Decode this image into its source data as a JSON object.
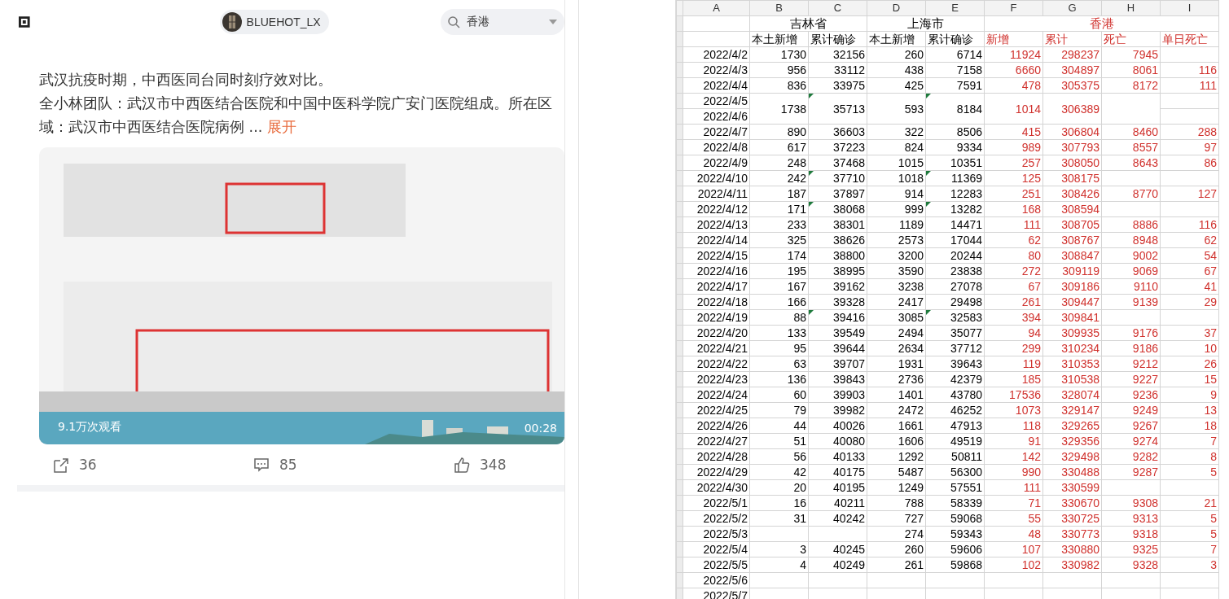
{
  "feed": {
    "user": {
      "name": "BLUEHOT_LX"
    },
    "search": {
      "value": "香港"
    },
    "post": {
      "lines": [
        "武汉抗疫时期，中西医同台同时刻疗效对比。",
        "全小林团队：武汉市中西医结合医院和中国中医科学院广安门医院组成。所在区域：武汉市中西医结合医院病例  ..."
      ],
      "expand": "展开",
      "video": {
        "kind": "picture",
        "views": "9.1万次观看",
        "duration": "00:28"
      },
      "actions": [
        {
          "kind": "share",
          "count": "36"
        },
        {
          "kind": "comment",
          "count": "85"
        },
        {
          "kind": "like",
          "count": "348"
        }
      ]
    }
  },
  "sheet": {
    "column_letters": [
      "A",
      "B",
      "C",
      "D",
      "E",
      "F",
      "G",
      "H",
      "I"
    ],
    "groups": [
      {
        "label": "吉林省",
        "color": "#000000",
        "subheads": [
          "本土新增",
          "累计确诊"
        ]
      },
      {
        "label": "上海市",
        "color": "#000000",
        "subheads": [
          "本土新增",
          "累计确诊"
        ]
      },
      {
        "label": "香港",
        "color": "#d0312d",
        "subheads": [
          "新增",
          "累计",
          "死亡",
          "单日死亡"
        ]
      }
    ],
    "rows": [
      {
        "dates": [
          "2022/4/2"
        ],
        "flagged": false,
        "B": "1730",
        "C": "32156",
        "D": "260",
        "E": "6714",
        "F": "11924",
        "G": "298237",
        "H": "7945"
      },
      {
        "dates": [
          "2022/4/3"
        ],
        "flagged": false,
        "B": "956",
        "C": "33112",
        "D": "438",
        "E": "7158",
        "F": "6660",
        "G": "304897",
        "H": "8061",
        "I": "116"
      },
      {
        "dates": [
          "2022/4/4"
        ],
        "flagged": false,
        "B": "836",
        "C": "33975",
        "D": "425",
        "E": "7591",
        "F": "478",
        "G": "305375",
        "H": "8172",
        "I": "111"
      },
      {
        "dates": [
          "2022/4/5",
          "2022/4/6"
        ],
        "flagged": true,
        "B": "1738",
        "C": "35713",
        "D": "593",
        "E": "8184",
        "F": "1014",
        "G": "306389"
      },
      {
        "dates": [
          "2022/4/7"
        ],
        "flagged": false,
        "B": "890",
        "C": "36603",
        "D": "322",
        "E": "8506",
        "F": "415",
        "G": "306804",
        "H": "8460",
        "I": "288"
      },
      {
        "dates": [
          "2022/4/8"
        ],
        "flagged": false,
        "B": "617",
        "C": "37223",
        "D": "824",
        "E": "9334",
        "F": "989",
        "G": "307793",
        "H": "8557",
        "I": "97"
      },
      {
        "dates": [
          "2022/4/9"
        ],
        "flagged": false,
        "B": "248",
        "C": "37468",
        "D": "1015",
        "E": "10351",
        "F": "257",
        "G": "308050",
        "H": "8643",
        "I": "86"
      },
      {
        "dates": [
          "2022/4/10"
        ],
        "flagged": true,
        "B": "242",
        "C": "37710",
        "D": "1018",
        "E": "11369",
        "F": "125",
        "G": "308175"
      },
      {
        "dates": [
          "2022/4/11"
        ],
        "flagged": false,
        "B": "187",
        "C": "37897",
        "D": "914",
        "E": "12283",
        "F": "251",
        "G": "308426",
        "H": "8770",
        "I": "127"
      },
      {
        "dates": [
          "2022/4/12"
        ],
        "flagged": true,
        "B": "171",
        "C": "38068",
        "D": "999",
        "E": "13282",
        "F": "168",
        "G": "308594"
      },
      {
        "dates": [
          "2022/4/13"
        ],
        "flagged": false,
        "B": "233",
        "C": "38301",
        "D": "1189",
        "E": "14471",
        "F": "111",
        "G": "308705",
        "H": "8886",
        "I": "116"
      },
      {
        "dates": [
          "2022/4/14"
        ],
        "flagged": false,
        "B": "325",
        "C": "38626",
        "D": "2573",
        "E": "17044",
        "F": "62",
        "G": "308767",
        "H": "8948",
        "I": "62"
      },
      {
        "dates": [
          "2022/4/15"
        ],
        "flagged": false,
        "B": "174",
        "C": "38800",
        "D": "3200",
        "E": "20244",
        "F": "80",
        "G": "308847",
        "H": "9002",
        "I": "54"
      },
      {
        "dates": [
          "2022/4/16"
        ],
        "flagged": false,
        "B": "195",
        "C": "38995",
        "D": "3590",
        "E": "23838",
        "F": "272",
        "G": "309119",
        "H": "9069",
        "I": "67"
      },
      {
        "dates": [
          "2022/4/17"
        ],
        "flagged": false,
        "B": "167",
        "C": "39162",
        "D": "3238",
        "E": "27078",
        "F": "67",
        "G": "309186",
        "H": "9110",
        "I": "41"
      },
      {
        "dates": [
          "2022/4/18"
        ],
        "flagged": false,
        "B": "166",
        "C": "39328",
        "D": "2417",
        "E": "29498",
        "F": "261",
        "G": "309447",
        "H": "9139",
        "I": "29"
      },
      {
        "dates": [
          "2022/4/19"
        ],
        "flagged": true,
        "B": "88",
        "C": "39416",
        "D": "3085",
        "E": "32583",
        "F": "394",
        "G": "309841"
      },
      {
        "dates": [
          "2022/4/20"
        ],
        "flagged": false,
        "B": "133",
        "C": "39549",
        "D": "2494",
        "E": "35077",
        "F": "94",
        "G": "309935",
        "H": "9176",
        "I": "37"
      },
      {
        "dates": [
          "2022/4/21"
        ],
        "flagged": false,
        "B": "95",
        "C": "39644",
        "D": "2634",
        "E": "37712",
        "F": "299",
        "G": "310234",
        "H": "9186",
        "I": "10"
      },
      {
        "dates": [
          "2022/4/22"
        ],
        "flagged": false,
        "B": "63",
        "C": "39707",
        "D": "1931",
        "E": "39643",
        "F": "119",
        "G": "310353",
        "H": "9212",
        "I": "26"
      },
      {
        "dates": [
          "2022/4/23"
        ],
        "flagged": false,
        "B": "136",
        "C": "39843",
        "D": "2736",
        "E": "42379",
        "F": "185",
        "G": "310538",
        "H": "9227",
        "I": "15"
      },
      {
        "dates": [
          "2022/4/24"
        ],
        "flagged": false,
        "B": "60",
        "C": "39903",
        "D": "1401",
        "E": "43780",
        "F": "17536",
        "G": "328074",
        "H": "9236",
        "I": "9"
      },
      {
        "dates": [
          "2022/4/25"
        ],
        "flagged": false,
        "B": "79",
        "C": "39982",
        "D": "2472",
        "E": "46252",
        "F": "1073",
        "G": "329147",
        "H": "9249",
        "I": "13"
      },
      {
        "dates": [
          "2022/4/26"
        ],
        "flagged": false,
        "B": "44",
        "C": "40026",
        "D": "1661",
        "E": "47913",
        "F": "118",
        "G": "329265",
        "H": "9267",
        "I": "18"
      },
      {
        "dates": [
          "2022/4/27"
        ],
        "flagged": false,
        "B": "51",
        "C": "40080",
        "D": "1606",
        "E": "49519",
        "F": "91",
        "G": "329356",
        "H": "9274",
        "I": "7"
      },
      {
        "dates": [
          "2022/4/28"
        ],
        "flagged": false,
        "B": "56",
        "C": "40133",
        "D": "1292",
        "E": "50811",
        "F": "142",
        "G": "329498",
        "H": "9282",
        "I": "8"
      },
      {
        "dates": [
          "2022/4/29"
        ],
        "flagged": false,
        "B": "42",
        "C": "40175",
        "D": "5487",
        "E": "56300",
        "F": "990",
        "G": "330488",
        "H": "9287",
        "I": "5"
      },
      {
        "dates": [
          "2022/4/30"
        ],
        "flagged": false,
        "B": "20",
        "C": "40195",
        "D": "1249",
        "E": "57551",
        "F": "111",
        "G": "330599"
      },
      {
        "dates": [
          "2022/5/1"
        ],
        "flagged": false,
        "B": "16",
        "C": "40211",
        "D": "788",
        "E": "58339",
        "F": "71",
        "G": "330670",
        "H": "9308",
        "I": "21"
      },
      {
        "dates": [
          "2022/5/2"
        ],
        "flagged": false,
        "B": "31",
        "C": "40242",
        "D": "727",
        "E": "59068",
        "F": "55",
        "G": "330725",
        "H": "9313",
        "I": "5"
      },
      {
        "dates": [
          "2022/5/3"
        ],
        "flagged": false,
        "D": "274",
        "E": "59343",
        "F": "48",
        "G": "330773",
        "H": "9318",
        "I": "5"
      },
      {
        "dates": [
          "2022/5/4"
        ],
        "flagged": false,
        "B": "3",
        "C": "40245",
        "D": "260",
        "E": "59606",
        "F": "107",
        "G": "330880",
        "H": "9325",
        "I": "7"
      },
      {
        "dates": [
          "2022/5/5"
        ],
        "flagged": false,
        "B": "4",
        "C": "40249",
        "D": "261",
        "E": "59868",
        "F": "102",
        "G": "330982",
        "H": "9328",
        "I": "3"
      },
      {
        "dates": [
          "2022/5/6"
        ],
        "flagged": false
      },
      {
        "dates": [
          "2022/5/7"
        ],
        "flagged": false
      }
    ]
  }
}
